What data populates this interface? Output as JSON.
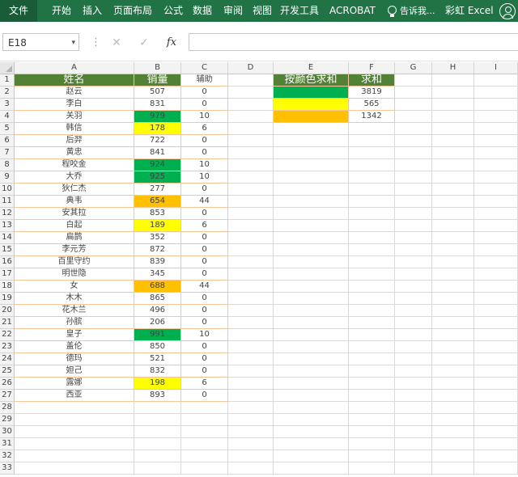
{
  "ribbon": {
    "file": "文件",
    "tabs": [
      "开始",
      "插入",
      "页面布局",
      "公式",
      "数据",
      "审阅",
      "视图",
      "开发工具",
      "ACROBAT"
    ],
    "tell_me": "告诉我...",
    "user": "彩虹 Excel"
  },
  "formula_bar": {
    "name_box": "E18",
    "dropdown": "▾",
    "separator": "⋮",
    "cancel": "✕",
    "enter": "✓",
    "fx": "fx",
    "formula": ""
  },
  "columns": [
    "A",
    "B",
    "C",
    "D",
    "E",
    "F",
    "G",
    "H",
    "I"
  ],
  "row_numbers": [
    1,
    2,
    3,
    4,
    5,
    6,
    7,
    8,
    9,
    10,
    11,
    12,
    13,
    14,
    15,
    16,
    17,
    18,
    19,
    20,
    21,
    22,
    23,
    24,
    25,
    26,
    27,
    28,
    29,
    30,
    31,
    32,
    33
  ],
  "table_header": {
    "name": "姓名",
    "sales": "销量",
    "helper": "辅助"
  },
  "rows": [
    {
      "name": "赵云",
      "sales": "507",
      "helper": "0",
      "fill": ""
    },
    {
      "name": "李白",
      "sales": "831",
      "helper": "0",
      "fill": ""
    },
    {
      "name": "关羽",
      "sales": "979",
      "helper": "10",
      "fill": "#00b050"
    },
    {
      "name": "韩信",
      "sales": "178",
      "helper": "6",
      "fill": "#ffff00"
    },
    {
      "name": "后羿",
      "sales": "722",
      "helper": "0",
      "fill": ""
    },
    {
      "name": "黄忠",
      "sales": "841",
      "helper": "0",
      "fill": ""
    },
    {
      "name": "程咬金",
      "sales": "924",
      "helper": "10",
      "fill": "#00b050"
    },
    {
      "name": "大乔",
      "sales": "925",
      "helper": "10",
      "fill": "#00b050"
    },
    {
      "name": "狄仁杰",
      "sales": "277",
      "helper": "0",
      "fill": ""
    },
    {
      "name": "典韦",
      "sales": "654",
      "helper": "44",
      "fill": "#ffc000"
    },
    {
      "name": "安其拉",
      "sales": "853",
      "helper": "0",
      "fill": ""
    },
    {
      "name": "白起",
      "sales": "189",
      "helper": "6",
      "fill": "#ffff00"
    },
    {
      "name": "扁鹊",
      "sales": "352",
      "helper": "0",
      "fill": ""
    },
    {
      "name": "李元芳",
      "sales": "872",
      "helper": "0",
      "fill": ""
    },
    {
      "name": "百里守约",
      "sales": "839",
      "helper": "0",
      "fill": ""
    },
    {
      "name": "明世隐",
      "sales": "345",
      "helper": "0",
      "fill": ""
    },
    {
      "name": "女",
      "sales": "688",
      "helper": "44",
      "fill": "#ffc000"
    },
    {
      "name": "木木",
      "sales": "865",
      "helper": "0",
      "fill": ""
    },
    {
      "name": "花木兰",
      "sales": "496",
      "helper": "0",
      "fill": ""
    },
    {
      "name": "孙膑",
      "sales": "206",
      "helper": "0",
      "fill": ""
    },
    {
      "name": "皇子",
      "sales": "991",
      "helper": "10",
      "fill": "#00b050"
    },
    {
      "name": "盖伦",
      "sales": "850",
      "helper": "0",
      "fill": ""
    },
    {
      "name": "德玛",
      "sales": "521",
      "helper": "0",
      "fill": ""
    },
    {
      "name": "妲己",
      "sales": "832",
      "helper": "0",
      "fill": ""
    },
    {
      "name": "露娜",
      "sales": "198",
      "helper": "6",
      "fill": "#ffff00"
    },
    {
      "name": "西亚",
      "sales": "893",
      "helper": "0",
      "fill": ""
    }
  ],
  "summary_header": {
    "by_color": "按颜色求和",
    "sum": "求和"
  },
  "summary_rows": [
    {
      "fill": "#00b050",
      "sum": "3819"
    },
    {
      "fill": "#ffff00",
      "sum": "565"
    },
    {
      "fill": "#ffc000",
      "sum": "1342"
    }
  ],
  "colors": {
    "ribbon": "#217346",
    "header_fill": "#538135",
    "green": "#00b050",
    "yellow": "#ffff00",
    "orange": "#ffc000"
  }
}
